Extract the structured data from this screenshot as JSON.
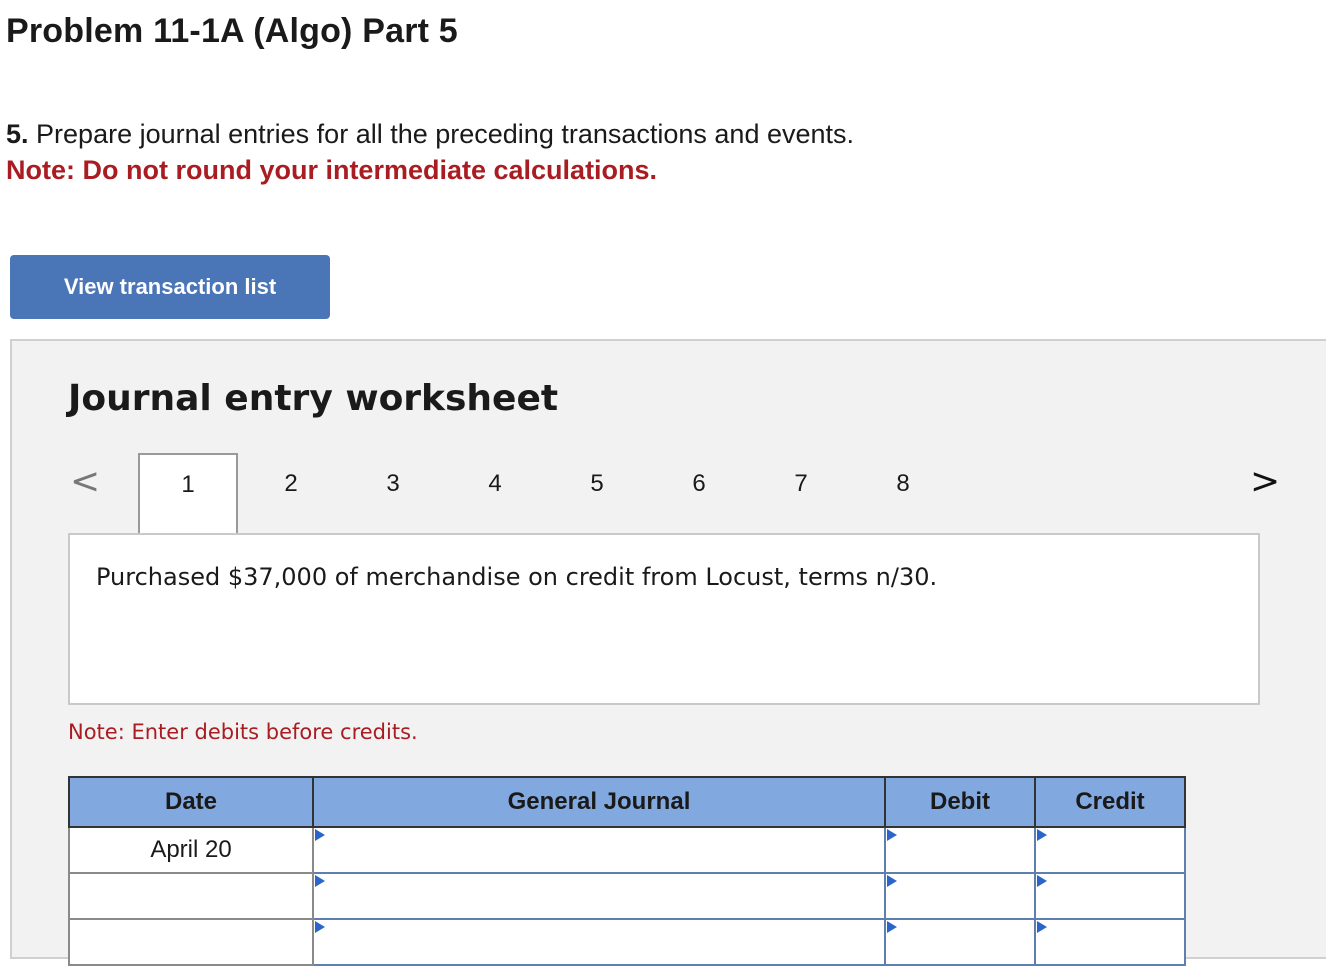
{
  "header": {
    "title": "Problem 11-1A (Algo) Part 5"
  },
  "instructions": {
    "number": "5.",
    "text": " Prepare journal entries for all the preceding transactions and events.",
    "note": "Note: Do not round your intermediate calculations."
  },
  "buttons": {
    "view_transactions": "View transaction list"
  },
  "worksheet": {
    "title": "Journal entry worksheet",
    "prev_icon": "<",
    "next_icon": ">",
    "tabs": [
      "1",
      "2",
      "3",
      "4",
      "5",
      "6",
      "7",
      "8"
    ],
    "active_tab": "1",
    "description": "Purchased $37,000 of merchandise on credit from Locust, terms n/30.",
    "note": "Note: Enter debits before credits."
  },
  "journal": {
    "headers": [
      "Date",
      "General Journal",
      "Debit",
      "Credit"
    ],
    "rows": [
      {
        "date": "April 20",
        "account": "",
        "debit": "",
        "credit": ""
      },
      {
        "date": "",
        "account": "",
        "debit": "",
        "credit": ""
      },
      {
        "date": "",
        "account": "",
        "debit": "",
        "credit": ""
      }
    ]
  },
  "colors": {
    "accent_button": "#4a76b8",
    "note_red": "#a91d22",
    "table_header": "#82a8e0",
    "cell_marker": "#2a66c9"
  }
}
